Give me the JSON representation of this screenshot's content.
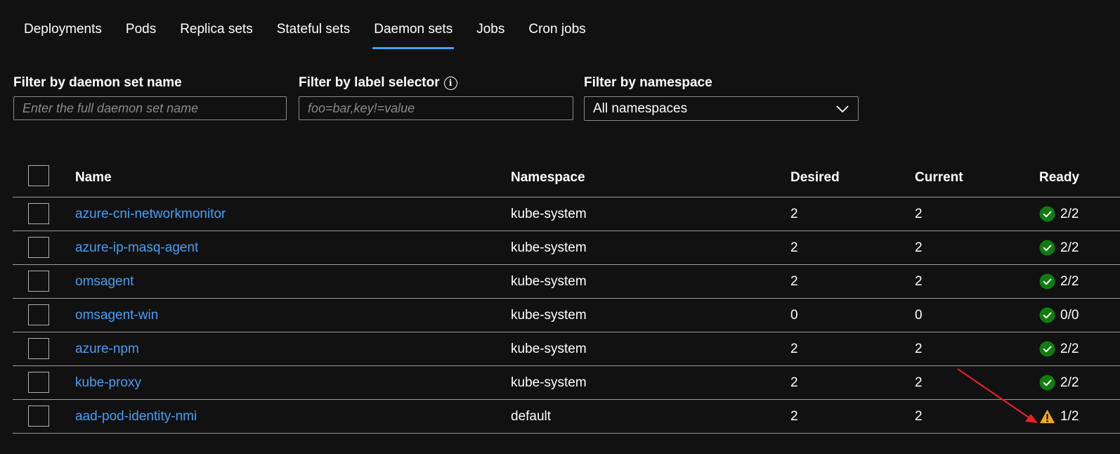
{
  "tabs": [
    {
      "label": "Deployments",
      "active": false
    },
    {
      "label": "Pods",
      "active": false
    },
    {
      "label": "Replica sets",
      "active": false
    },
    {
      "label": "Stateful sets",
      "active": false
    },
    {
      "label": "Daemon sets",
      "active": true
    },
    {
      "label": "Jobs",
      "active": false
    },
    {
      "label": "Cron jobs",
      "active": false
    }
  ],
  "filters": {
    "name": {
      "label": "Filter by daemon set name",
      "placeholder": "Enter the full daemon set name",
      "value": ""
    },
    "label_selector": {
      "label": "Filter by label selector",
      "placeholder": "foo=bar,key!=value",
      "value": "",
      "info_icon": "info-icon"
    },
    "namespace": {
      "label": "Filter by namespace",
      "selected": "All namespaces",
      "icon": "chevron-down-icon"
    }
  },
  "table": {
    "columns": {
      "name": "Name",
      "namespace": "Namespace",
      "desired": "Desired",
      "current": "Current",
      "ready": "Ready"
    },
    "rows": [
      {
        "name": "azure-cni-networkmonitor",
        "namespace": "kube-system",
        "desired": "2",
        "current": "2",
        "ready": "2/2",
        "status": "ok"
      },
      {
        "name": "azure-ip-masq-agent",
        "namespace": "kube-system",
        "desired": "2",
        "current": "2",
        "ready": "2/2",
        "status": "ok"
      },
      {
        "name": "omsagent",
        "namespace": "kube-system",
        "desired": "2",
        "current": "2",
        "ready": "2/2",
        "status": "ok"
      },
      {
        "name": "omsagent-win",
        "namespace": "kube-system",
        "desired": "0",
        "current": "0",
        "ready": "0/0",
        "status": "ok"
      },
      {
        "name": "azure-npm",
        "namespace": "kube-system",
        "desired": "2",
        "current": "2",
        "ready": "2/2",
        "status": "ok"
      },
      {
        "name": "kube-proxy",
        "namespace": "kube-system",
        "desired": "2",
        "current": "2",
        "ready": "2/2",
        "status": "ok"
      },
      {
        "name": "aad-pod-identity-nmi",
        "namespace": "default",
        "desired": "2",
        "current": "2",
        "ready": "1/2",
        "status": "warning"
      }
    ]
  },
  "colors": {
    "background": "#111111",
    "accent": "#479ef5",
    "link": "#479ef5",
    "success": "#107c10",
    "warning": "#f2a71b",
    "annotation_arrow": "#e02424"
  },
  "icons": {
    "ok": "check-circle-icon",
    "warning": "warning-triangle-icon"
  }
}
